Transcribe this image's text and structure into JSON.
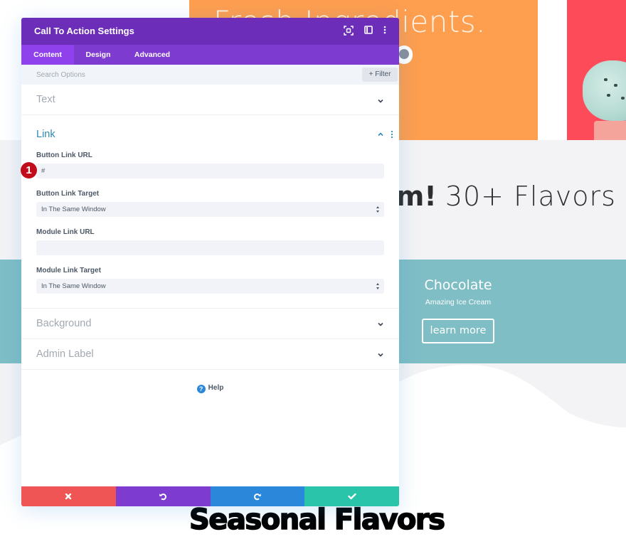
{
  "background_page": {
    "hero_headline": "Fresh Ingredients.",
    "flavors_heading_bold": "Yum!",
    "flavors_heading_rest": "30+ Flavors",
    "promo": {
      "title": "Chocolate",
      "subtitle": "Amazing Ice Cream",
      "button_label": "learn more"
    },
    "section_heading": "Seasonal Flavors",
    "colors": {
      "orange_card": "#fe9e4f",
      "red_card": "#fe4b5a",
      "teal_band": "#7fbec5",
      "gray_band": "#f3f3f5"
    }
  },
  "modal": {
    "title": "Call To Action Settings",
    "header_icons": [
      "fullscreen-icon",
      "split-view-icon",
      "more-options-icon"
    ],
    "tabs": [
      {
        "label": "Content",
        "active": true
      },
      {
        "label": "Design",
        "active": false
      },
      {
        "label": "Advanced",
        "active": false
      }
    ],
    "search": {
      "placeholder": "Search Options",
      "value": ""
    },
    "filter_label": "+ Filter",
    "sections": {
      "text": {
        "title": "Text",
        "expanded": false
      },
      "link": {
        "title": "Link",
        "expanded": true,
        "fields": {
          "button_link_url": {
            "label": "Button Link URL",
            "value": "#"
          },
          "button_link_target": {
            "label": "Button Link Target",
            "value": "In The Same Window"
          },
          "module_link_url": {
            "label": "Module Link URL",
            "value": ""
          },
          "module_link_target": {
            "label": "Module Link Target",
            "value": "In The Same Window"
          }
        }
      },
      "background": {
        "title": "Background",
        "expanded": false
      },
      "admin_label": {
        "title": "Admin Label",
        "expanded": false
      }
    },
    "step_badge": "1",
    "help_label": "Help",
    "footer_buttons": [
      {
        "name": "cancel",
        "icon": "close-icon",
        "color": "#ef5555"
      },
      {
        "name": "undo",
        "icon": "undo-icon",
        "color": "#7e3bd0"
      },
      {
        "name": "redo",
        "icon": "redo-icon",
        "color": "#2b87da"
      },
      {
        "name": "save",
        "icon": "check-icon",
        "color": "#29c4a9"
      }
    ],
    "colors": {
      "header": "#6c2eb9",
      "tabs": "#7e3bd0",
      "active_tab": "#8f42ec",
      "open_section_title": "#2e8ab3",
      "badge": "#c10c1b"
    }
  }
}
